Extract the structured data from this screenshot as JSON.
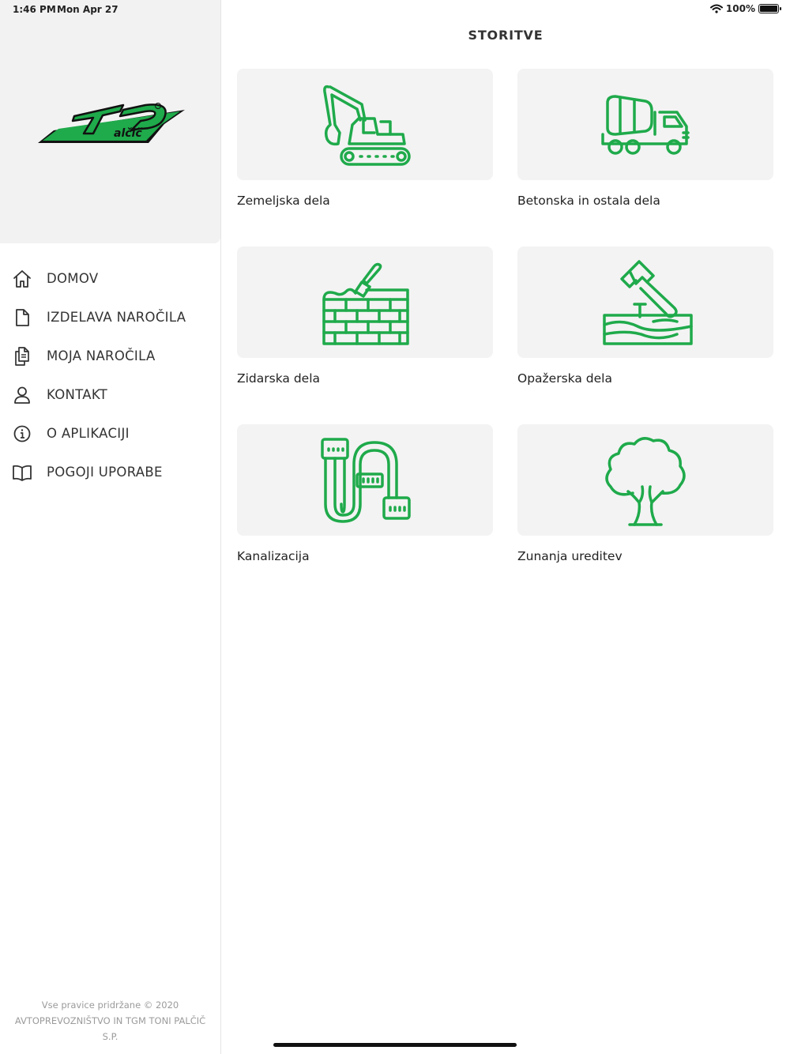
{
  "status_bar": {
    "time": "1:46 PM",
    "date": "Mon Apr 27",
    "battery": "100%"
  },
  "brand": {
    "accent_color": "#1faa4b",
    "logo_icon": "tp-palcic-logo"
  },
  "sidebar": {
    "items": [
      {
        "label": "DOMOV",
        "icon": "home-icon"
      },
      {
        "label": "IZDELAVA NAROČILA",
        "icon": "document-icon"
      },
      {
        "label": "MOJA NAROČILA",
        "icon": "documents-icon"
      },
      {
        "label": "KONTAKT",
        "icon": "person-icon"
      },
      {
        "label": "O APLIKACIJI",
        "icon": "info-icon"
      },
      {
        "label": "POGOJI UPORABE",
        "icon": "book-icon"
      }
    ],
    "footer": {
      "line1": "Vse pravice pridržane © 2020",
      "line2": "AVTOPREVOZNIŠTVO IN TGM TONI PALČIČ S.P."
    }
  },
  "main": {
    "title": "STORITVE",
    "services": [
      {
        "label": "Zemeljska dela",
        "icon": "excavator-icon"
      },
      {
        "label": "Betonska in ostala dela",
        "icon": "concrete-mixer-truck-icon"
      },
      {
        "label": "Zidarska dela",
        "icon": "brick-wall-trowel-icon"
      },
      {
        "label": "Opažerska dela",
        "icon": "hammer-wood-icon"
      },
      {
        "label": "Kanalizacija",
        "icon": "pipe-icon"
      },
      {
        "label": "Zunanja ureditev",
        "icon": "tree-icon"
      }
    ]
  }
}
